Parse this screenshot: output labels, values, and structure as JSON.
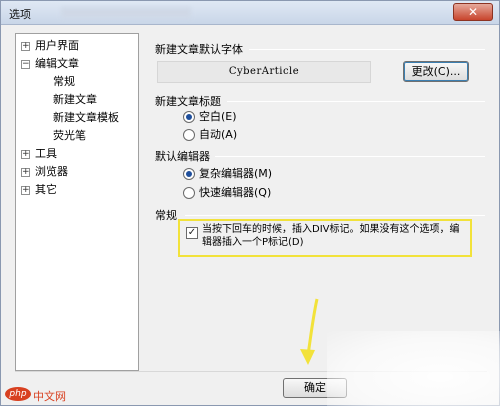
{
  "window": {
    "title": "选项",
    "close_glyph": "✕"
  },
  "tree": {
    "items": [
      {
        "label": "用户界面",
        "expander": "+"
      },
      {
        "label": "编辑文章",
        "expander": "−"
      },
      {
        "label": "常规"
      },
      {
        "label": "新建文章"
      },
      {
        "label": "新建文章模板"
      },
      {
        "label": "荧光笔"
      },
      {
        "label": "工具",
        "expander": "+"
      },
      {
        "label": "浏览器",
        "expander": "+"
      },
      {
        "label": "其它",
        "expander": "+"
      }
    ]
  },
  "font_section": {
    "title": "新建文章默认字体",
    "preview": "CyberArticle",
    "change_button": "更改(C)..."
  },
  "title_section": {
    "title": "新建文章标题",
    "options": [
      {
        "label": "空白(E)",
        "selected": true
      },
      {
        "label": "自动(A)",
        "selected": false
      }
    ]
  },
  "editor_section": {
    "title": "默认编辑器",
    "options": [
      {
        "label": "复杂编辑器(M)",
        "selected": true
      },
      {
        "label": "快速编辑器(Q)",
        "selected": false
      }
    ]
  },
  "general_section": {
    "title": "常规",
    "checkbox": {
      "checked": true,
      "label": "当按下回车的时候，插入DIV标记。如果没有这个选项，编辑器插入一个P标记(D)"
    }
  },
  "footer": {
    "ok_button": "确定"
  },
  "watermark": {
    "logo": "php",
    "text": "中文网"
  },
  "colors": {
    "highlight": "#f2e23a",
    "arrow": "#f2e23a",
    "watermark": "#d84020"
  }
}
